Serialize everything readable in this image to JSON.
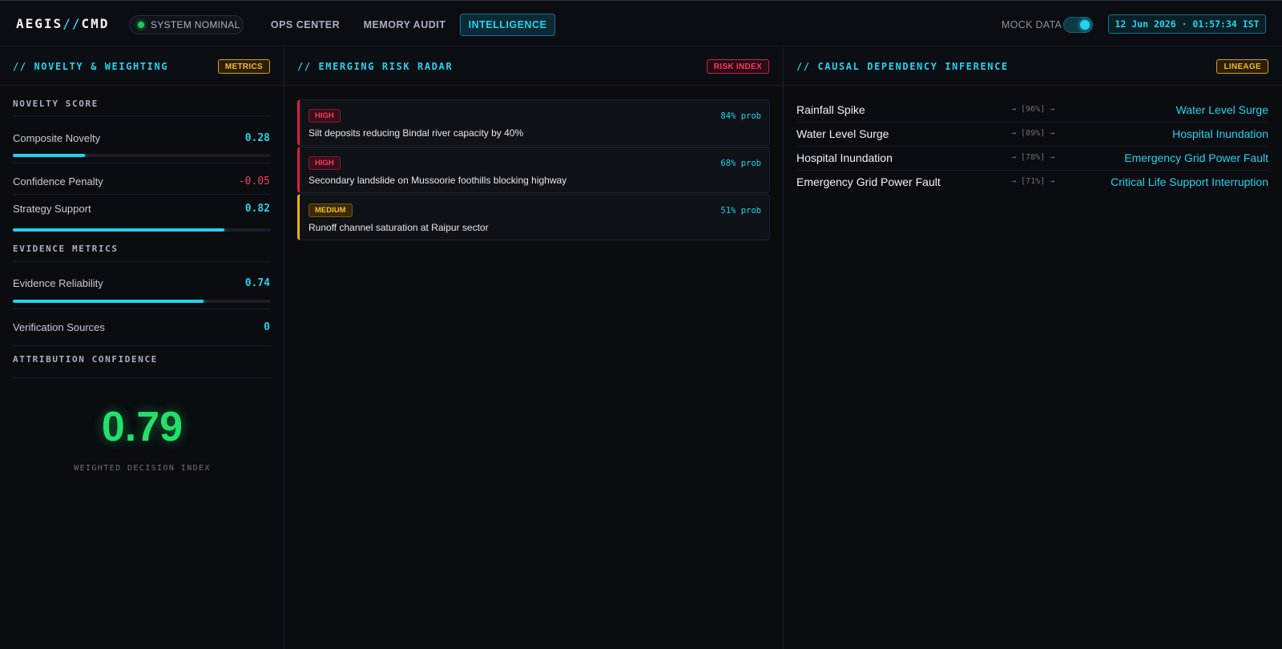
{
  "header": {
    "brand_prefix": "AEGIS",
    "brand_slashes": "//",
    "brand_suffix": "CMD",
    "status": "SYSTEM NOMINAL",
    "tabs": [
      "OPS CENTER",
      "MEMORY AUDIT",
      "INTELLIGENCE"
    ],
    "active_tab": "INTELLIGENCE",
    "mock_label": "MOCK DATA",
    "mock_enabled": true,
    "clock": "12 Jun 2026 · 01:57:34 IST"
  },
  "colors": {
    "accent": "#22d3ee",
    "success": "#22e06a",
    "danger": "#f43f5e",
    "warning": "#f5b82a",
    "background": "#0a0c10"
  },
  "novelty_panel": {
    "title": "// NOVELTY & WEIGHTING",
    "badge": "METRICS",
    "novelty_section": "NOVELTY SCORE",
    "composite_label": "Composite Novelty",
    "composite_value": "0.28",
    "composite_level": 0.28,
    "penalty_label": "Confidence Penalty",
    "penalty_value": "-0.05",
    "strategy_label": "Strategy Support",
    "strategy_value": "0.82",
    "strategy_level": 0.82,
    "evidence_section": "EVIDENCE METRICS",
    "reliability_label": "Evidence Reliability",
    "reliability_value": "0.74",
    "reliability_level": 0.74,
    "sources_label": "Verification Sources",
    "sources_value": "0",
    "attribution_section": "ATTRIBUTION CONFIDENCE",
    "attribution_score": "0.79",
    "attribution_caption": "WEIGHTED DECISION INDEX"
  },
  "risk_panel": {
    "title": "// EMERGING RISK RADAR",
    "badge": "RISK INDEX",
    "items": [
      {
        "severity": "HIGH",
        "prob": "84% prob",
        "text": "Silt deposits reducing Bindal river capacity by 40%"
      },
      {
        "severity": "HIGH",
        "prob": "68% prob",
        "text": "Secondary landslide on Mussoorie foothills blocking highway"
      },
      {
        "severity": "MEDIUM",
        "prob": "51% prob",
        "text": "Runoff channel saturation at Raipur sector"
      }
    ]
  },
  "causal_panel": {
    "title": "// CAUSAL DEPENDENCY INFERENCE",
    "badge": "LINEAGE",
    "links": [
      {
        "from": "Rainfall Spike",
        "weight": "→ [96%] →",
        "to": "Water Level Surge"
      },
      {
        "from": "Water Level Surge",
        "weight": "→ [89%] →",
        "to": "Hospital Inundation"
      },
      {
        "from": "Hospital Inundation",
        "weight": "→ [78%] →",
        "to": "Emergency Grid Power Fault"
      },
      {
        "from": "Emergency Grid Power Fault",
        "weight": "→ [71%] →",
        "to": "Critical Life Support Interruption"
      }
    ]
  }
}
